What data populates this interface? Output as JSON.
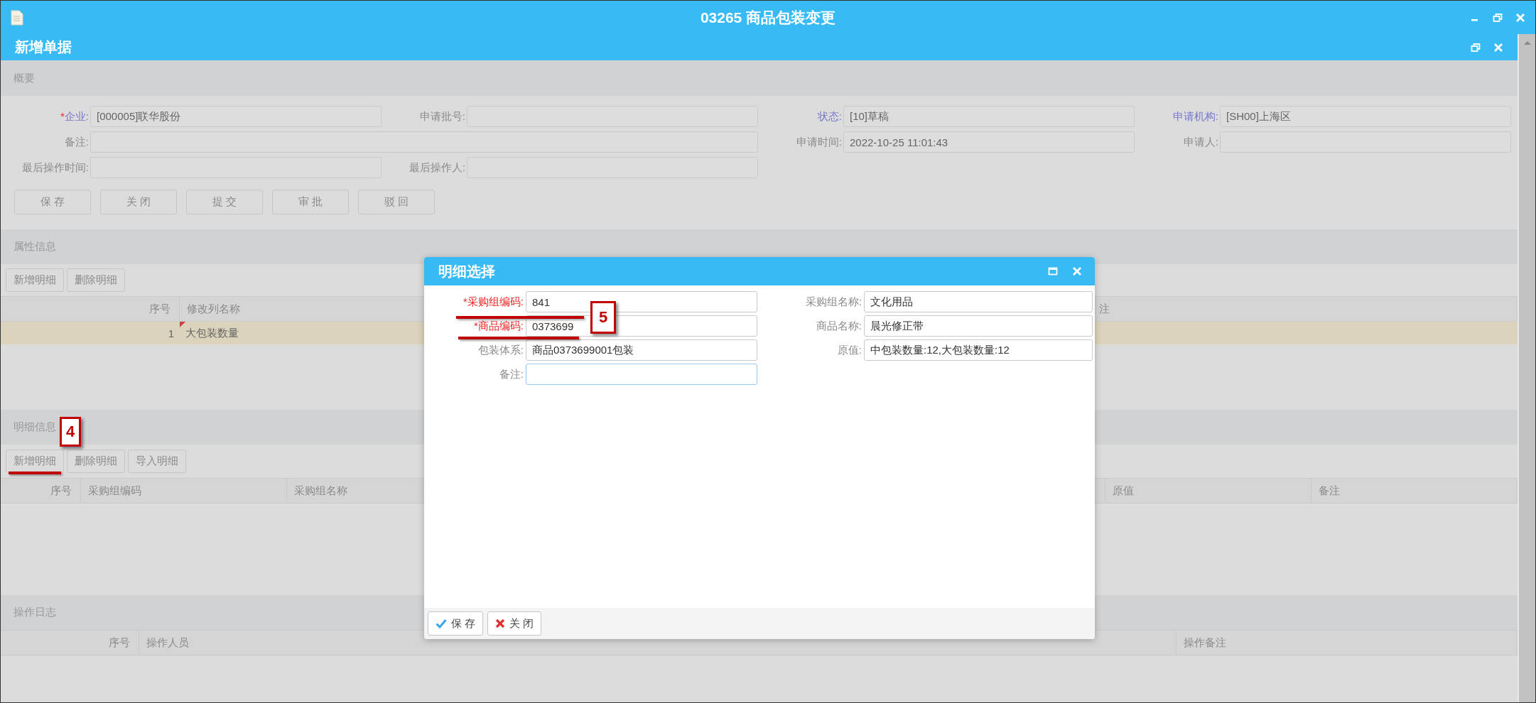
{
  "window": {
    "title": "03265 商品包装变更"
  },
  "document": {
    "title": "新增单据"
  },
  "summary": {
    "heading": "概要",
    "fields": [
      {
        "marker": "*",
        "label": "企业:",
        "link": true,
        "wide": false,
        "value": "[000005]联华股份"
      },
      {
        "label": "申请批号:",
        "link": false,
        "wide": false
      },
      {
        "label": "状态:",
        "link": true,
        "wide": false,
        "value": "[10]草稿"
      },
      {
        "label": "申请机构:",
        "link": true,
        "wide": false,
        "value": "[SH00]上海区"
      },
      {
        "label": "备注:",
        "link": false,
        "wide": true
      },
      {
        "label": "申请时间:",
        "link": false,
        "wide": false,
        "value": "2022-10-25 11:01:43"
      },
      {
        "label": "申请人:",
        "link": false,
        "wide": false
      },
      {
        "label": "最后操作时间:",
        "link": false,
        "wide": false
      },
      {
        "label": "最后操作人:",
        "link": false,
        "wide": false
      }
    ],
    "buttons": [
      "保 存",
      "关 闭",
      "提 交",
      "审 批",
      "驳 回"
    ]
  },
  "attributes": {
    "heading": "属性信息",
    "toolbar": [
      "新增明细",
      "删除明细"
    ],
    "columns": [
      "序号",
      "修改列名称",
      "注"
    ],
    "rows": [
      {
        "cells": [
          "1",
          "大包装数量"
        ],
        "selected": true,
        "edited": true
      }
    ]
  },
  "details": {
    "heading": "明细信息",
    "toolbar": [
      "新增明细",
      "删除明细",
      "导入明细"
    ],
    "columns": [
      "序号",
      "采购组编码",
      "采购组名称",
      "原值",
      "备注"
    ]
  },
  "log": {
    "heading": "操作日志",
    "columns": [
      "序号",
      "操作人员",
      "操作备注"
    ]
  },
  "dialog": {
    "title": "明细选择",
    "fields": [
      {
        "marker": "*",
        "label": "采购组编码:",
        "required": true,
        "focused": false,
        "value": "841"
      },
      {
        "label": "采购组名称:",
        "required": false,
        "focused": false,
        "value": "文化用品"
      },
      {
        "marker": "*",
        "label": "商品编码:",
        "required": true,
        "focused": false,
        "value": "0373699"
      },
      {
        "label": "商品名称:",
        "required": false,
        "focused": false,
        "value": "晨光修正带"
      },
      {
        "label": "包装体系:",
        "required": false,
        "focused": false,
        "value": "商品0373699001包装"
      },
      {
        "label": "原值:",
        "required": false,
        "focused": false,
        "value": "中包装数量:12,大包装数量:12"
      },
      {
        "label": "备注:",
        "required": false,
        "focused": true
      }
    ],
    "buttons": [
      {
        "kind": "save",
        "label": "保 存"
      },
      {
        "kind": "close",
        "label": "关 闭"
      }
    ]
  },
  "annotations": [
    {
      "number": "4"
    },
    {
      "number": "5"
    }
  ]
}
